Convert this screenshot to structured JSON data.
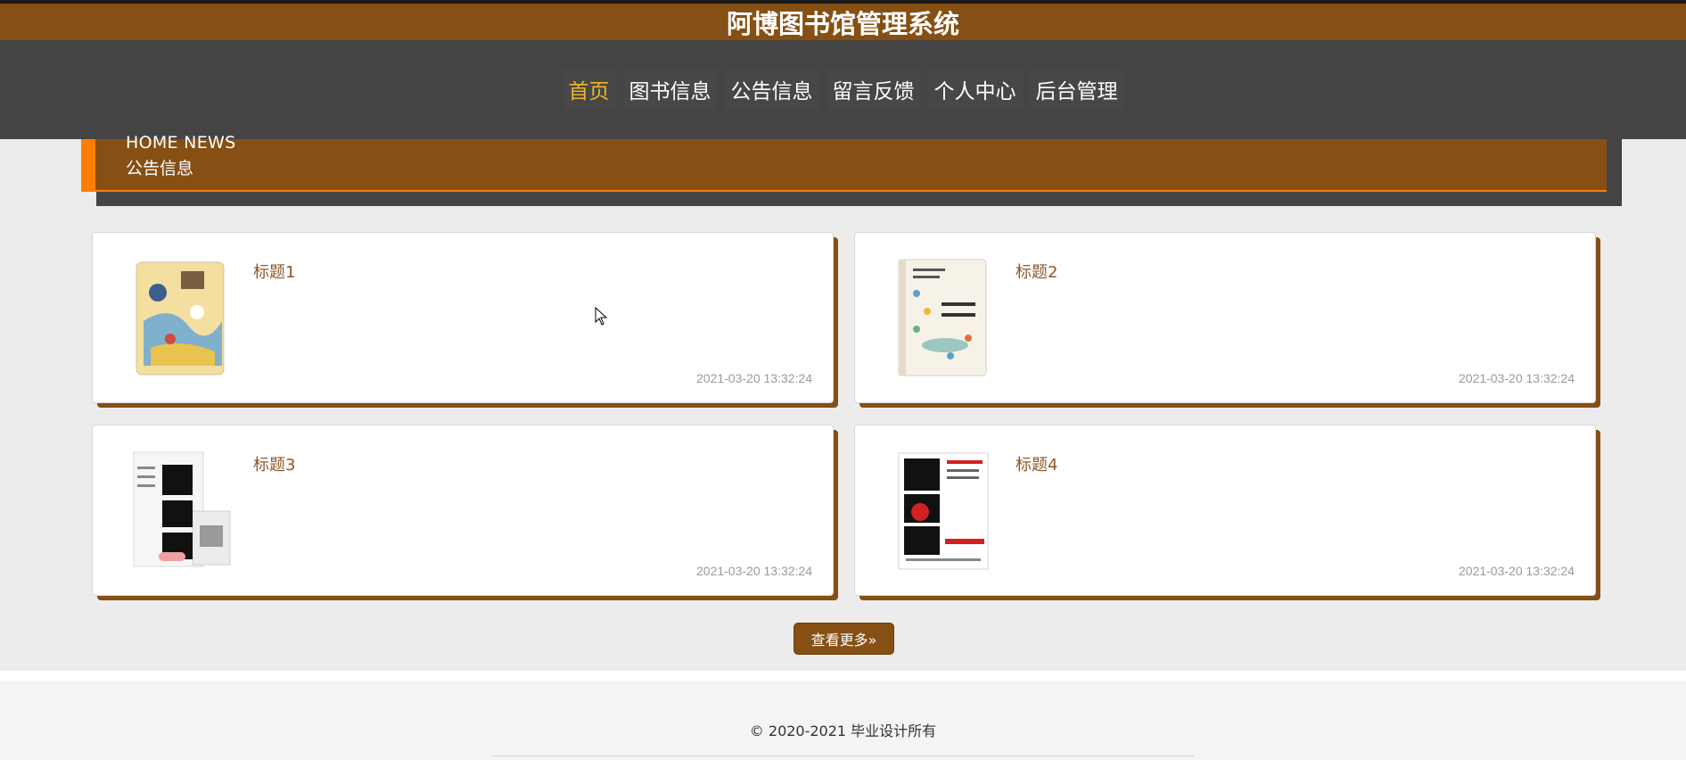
{
  "header": {
    "site_title": "阿博图书馆管理系统"
  },
  "nav": {
    "items": [
      {
        "label": "首页",
        "active": true
      },
      {
        "label": "图书信息",
        "active": false
      },
      {
        "label": "公告信息",
        "active": false
      },
      {
        "label": "留言反馈",
        "active": false
      },
      {
        "label": "个人中心",
        "active": false
      },
      {
        "label": "后台管理",
        "active": false
      }
    ]
  },
  "section": {
    "title_en": "HOME NEWS",
    "title_cn": "公告信息"
  },
  "news": {
    "items": [
      {
        "title": "标题1",
        "date": "2021-03-20 13:32:24",
        "cover": "book-cover-icon"
      },
      {
        "title": "标题2",
        "date": "2021-03-20 13:32:24",
        "cover": "book-cover-icon"
      },
      {
        "title": "标题3",
        "date": "2021-03-20 13:32:24",
        "cover": "book-cover-icon"
      },
      {
        "title": "标题4",
        "date": "2021-03-20 13:32:24",
        "cover": "book-cover-icon"
      }
    ],
    "more_label": "查看更多»"
  },
  "footer": {
    "copyright": "© 2020-2021 毕业设计所有"
  },
  "colors": {
    "brand": "#864f14",
    "nav_bg": "#444444",
    "accent": "#ff7d00",
    "active_nav": "#f0b825"
  }
}
